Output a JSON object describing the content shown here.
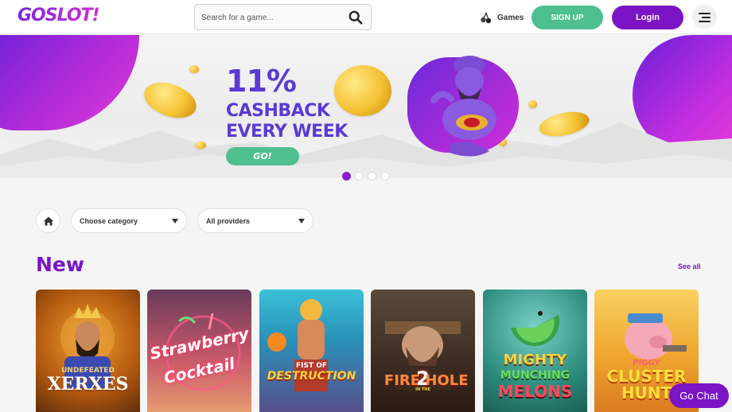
{
  "header": {
    "logo": "GOSLOT!",
    "search_placeholder": "Search for a game...",
    "games_label": "Games",
    "signup_label": "SIGN UP",
    "login_label": "Login"
  },
  "banner": {
    "line1": "11%",
    "line2": "CASHBACK",
    "line3": "EVERY WEEK",
    "button_label": "GO!",
    "slides_total": 4,
    "active_slide": 1
  },
  "filters": {
    "category_selected": "Choose category",
    "provider_selected": "All providers"
  },
  "section": {
    "title": "New",
    "see_all": "See all"
  },
  "games": [
    {
      "title_a": "UNDEFEATED",
      "title_b": "XERXES"
    },
    {
      "title_a": "Strawberry",
      "title_b": "Cocktail"
    },
    {
      "title_a": "FIST OF",
      "title_b": "DESTRUCTION"
    },
    {
      "title_a": "FIRE",
      "title_b": "2",
      "title_c": "IN THE",
      "title_d": "HOLE"
    },
    {
      "title_a": "MIGHTY",
      "title_b": "MUNCHING",
      "title_c": "MELONS"
    },
    {
      "title_a": "PIGGY",
      "title_b": "CLUSTER",
      "title_c": "HUNT"
    }
  ],
  "chat": {
    "label": "Go Chat"
  },
  "colors": {
    "brand_purple": "#7a14c4",
    "accent_green": "#4fbf8f",
    "promo_text": "#5a3ad4"
  }
}
